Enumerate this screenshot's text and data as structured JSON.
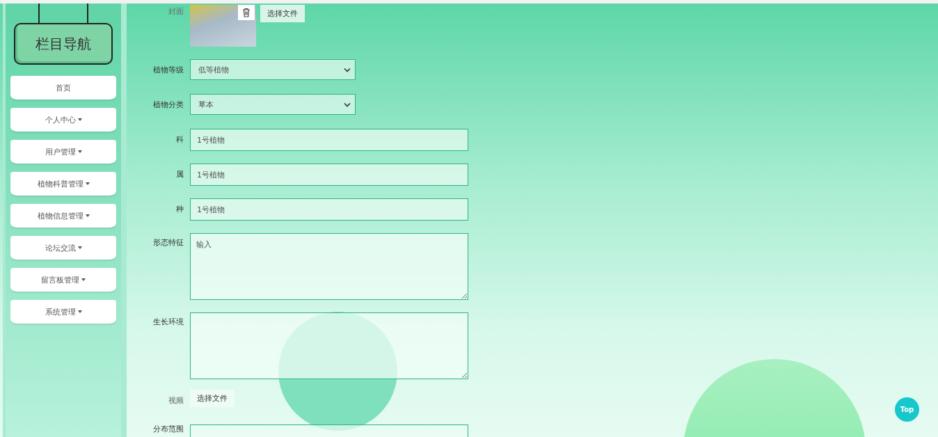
{
  "sidebar": {
    "title": "栏目导航",
    "items": [
      {
        "label": "首页",
        "has_menu": false
      },
      {
        "label": "个人中心",
        "has_menu": true
      },
      {
        "label": "用户管理",
        "has_menu": true
      },
      {
        "label": "植物科普管理",
        "has_menu": true
      },
      {
        "label": "植物信息管理",
        "has_menu": true
      },
      {
        "label": "论坛交流",
        "has_menu": true
      },
      {
        "label": "留言板管理",
        "has_menu": true
      },
      {
        "label": "系统管理",
        "has_menu": true
      }
    ]
  },
  "form": {
    "fields": [
      {
        "kind": "image",
        "label": "封面",
        "button": "选择文件"
      },
      {
        "kind": "select",
        "label": "植物等级",
        "value": "低等植物"
      },
      {
        "kind": "select",
        "label": "植物分类",
        "value": "草本"
      },
      {
        "kind": "input",
        "label": "科",
        "value": "1号植物"
      },
      {
        "kind": "input",
        "label": "属",
        "value": "1号植物"
      },
      {
        "kind": "input",
        "label": "种",
        "value": "1号植物"
      },
      {
        "kind": "textarea",
        "label": "形态特征",
        "value": "输入"
      },
      {
        "kind": "textarea",
        "label": "生长环境"
      },
      {
        "kind": "file",
        "label": "视频",
        "button": "选择文件"
      },
      {
        "kind": "input",
        "label": "分布范围"
      }
    ]
  },
  "top_button": "Top"
}
